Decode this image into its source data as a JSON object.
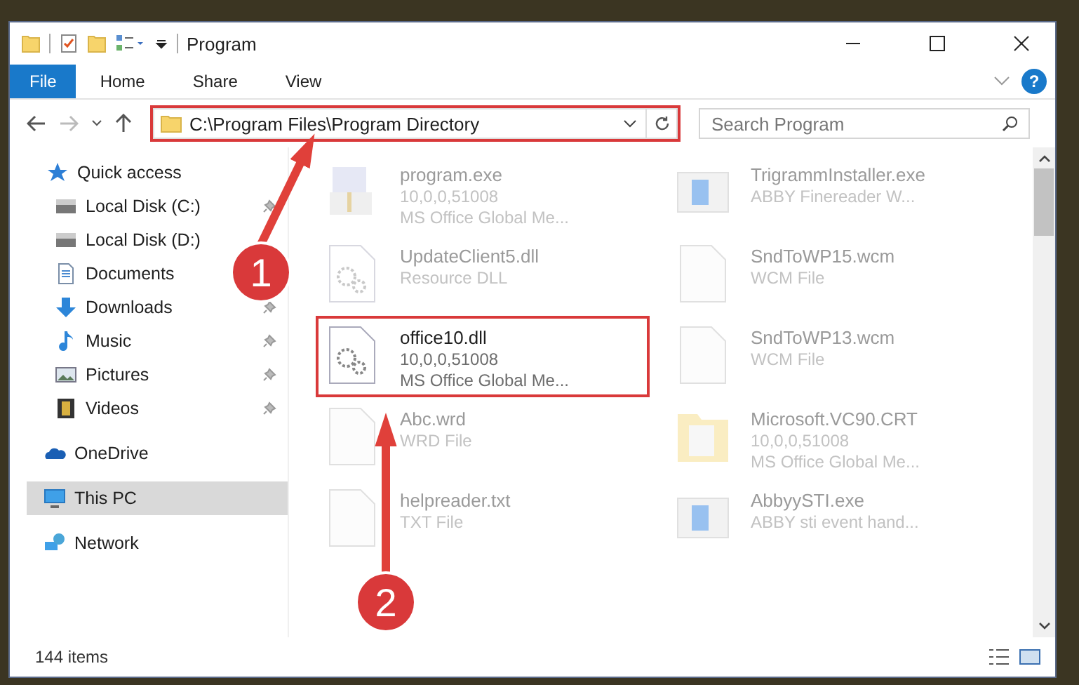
{
  "window": {
    "title": "Program"
  },
  "ribbon": {
    "tabs": [
      {
        "label": "File",
        "selected": true
      },
      {
        "label": "Home",
        "selected": false
      },
      {
        "label": "Share",
        "selected": false
      },
      {
        "label": "View",
        "selected": false
      }
    ],
    "help": "?"
  },
  "address_bar": {
    "path": "C:\\Program Files\\Program Directory",
    "highlighted": true
  },
  "search": {
    "placeholder": "Search Program"
  },
  "sidebar": {
    "items": [
      {
        "label": "Quick access",
        "kind": "star",
        "selected": false,
        "children": [
          {
            "label": "Local Disk (C:)",
            "kind": "drive",
            "pinned": true,
            "selected": false
          },
          {
            "label": "Local Disk (D:)",
            "kind": "drive",
            "pinned": false,
            "selected": false
          },
          {
            "label": "Documents",
            "kind": "document",
            "pinned": false,
            "selected": false
          },
          {
            "label": "Downloads",
            "kind": "download",
            "pinned": true,
            "selected": false
          },
          {
            "label": "Music",
            "kind": "music",
            "pinned": true,
            "selected": false
          },
          {
            "label": "Pictures",
            "kind": "picture",
            "pinned": true,
            "selected": false
          },
          {
            "label": "Videos",
            "kind": "video",
            "pinned": true,
            "selected": false
          }
        ]
      },
      {
        "label": "OneDrive",
        "kind": "cloud",
        "selected": false
      },
      {
        "label": "This PC",
        "kind": "computer",
        "selected": true
      },
      {
        "label": "Network",
        "kind": "network",
        "selected": false
      }
    ]
  },
  "files": [
    {
      "kind": "exe",
      "name": "program.exe",
      "details": [
        "10,0,0,51008",
        "MS Office Global Me..."
      ],
      "dimmed": true,
      "highlighted": false
    },
    {
      "kind": "app",
      "name": "TrigrammInstaller.exe",
      "details": [
        "ABBY Finereader W..."
      ],
      "dimmed": true,
      "highlighted": false
    },
    {
      "kind": "dll",
      "name": "UpdateClient5.dll",
      "details": [
        "Resource DLL"
      ],
      "dimmed": true,
      "highlighted": false
    },
    {
      "kind": "blank",
      "name": "SndToWP15.wcm",
      "details": [
        "WCM File"
      ],
      "dimmed": true,
      "highlighted": false
    },
    {
      "kind": "dll",
      "name": "office10.dll",
      "details": [
        "10,0,0,51008",
        "MS Office Global Me..."
      ],
      "dimmed": false,
      "highlighted": true
    },
    {
      "kind": "blank",
      "name": "SndToWP13.wcm",
      "details": [
        "WCM File"
      ],
      "dimmed": true,
      "highlighted": false
    },
    {
      "kind": "blank",
      "name": "Abc.wrd",
      "details": [
        "WRD File"
      ],
      "dimmed": true,
      "highlighted": false
    },
    {
      "kind": "folder",
      "name": "Microsoft.VC90.CRT",
      "details": [
        "10,0,0,51008",
        "MS Office Global Me..."
      ],
      "dimmed": true,
      "highlighted": false
    },
    {
      "kind": "blank",
      "name": "helpreader.txt",
      "details": [
        "TXT File"
      ],
      "dimmed": true,
      "highlighted": false
    },
    {
      "kind": "app",
      "name": "AbbyySTI.exe",
      "details": [
        "ABBY sti event hand..."
      ],
      "dimmed": true,
      "highlighted": false
    }
  ],
  "annotations": [
    {
      "number": "1"
    },
    {
      "number": "2"
    }
  ],
  "status_bar": {
    "count": "144 items"
  }
}
